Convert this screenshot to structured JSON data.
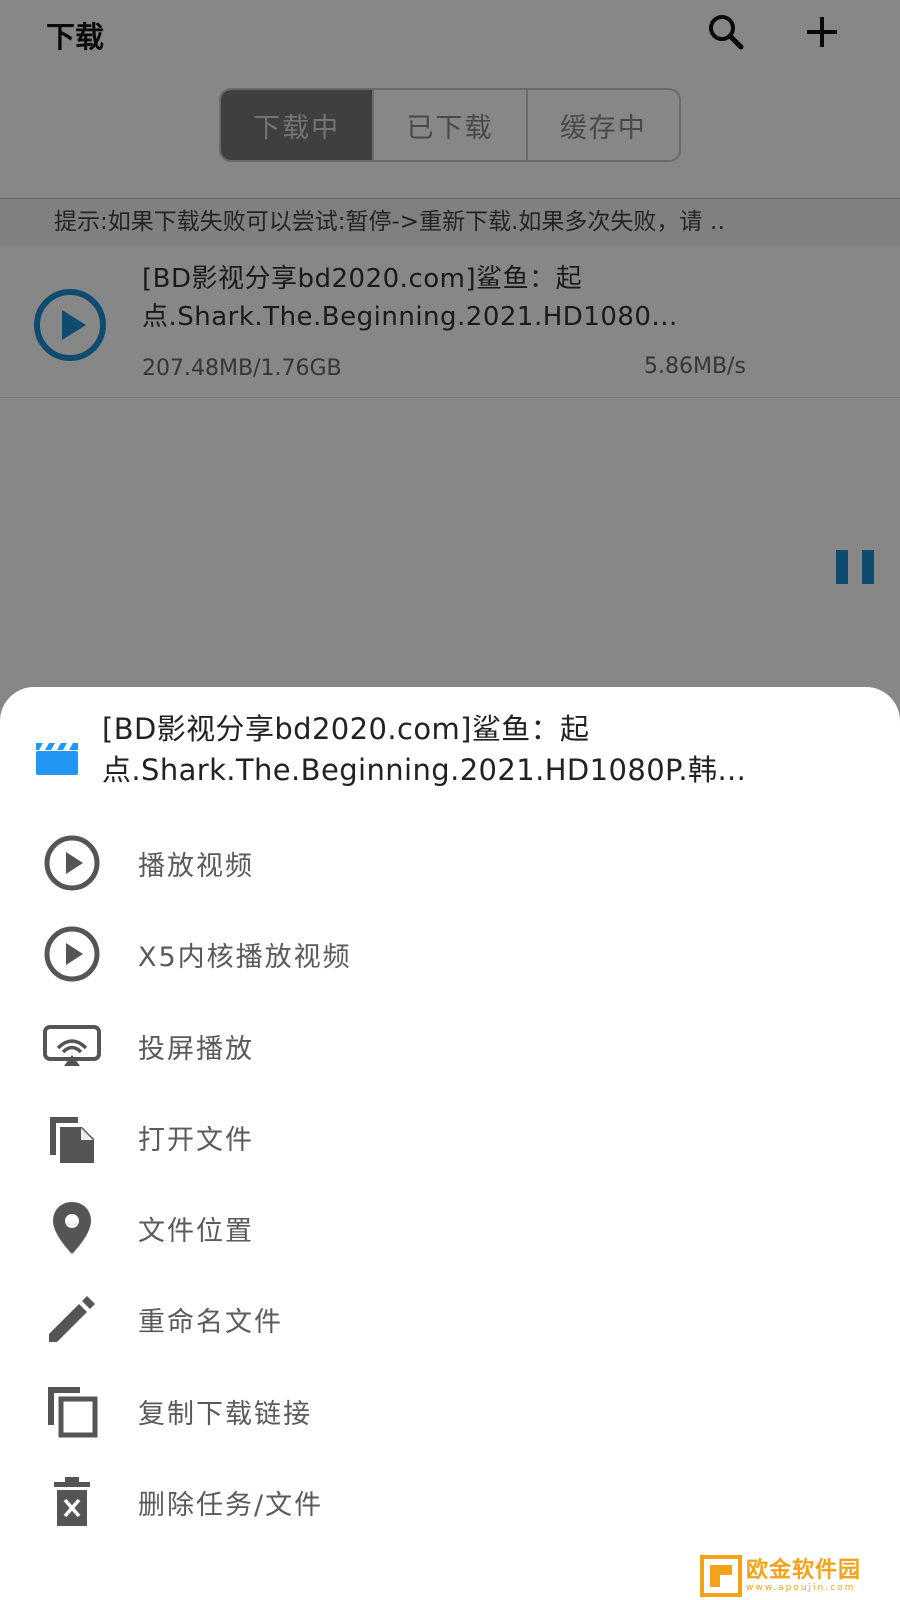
{
  "header": {
    "title": "下载",
    "search_icon": "search-icon",
    "add_icon": "plus-icon"
  },
  "tabs": [
    {
      "label": "下载中",
      "active": true
    },
    {
      "label": "已下载",
      "active": false
    },
    {
      "label": "缓存中",
      "active": false
    }
  ],
  "tip": "提示:如果下载失败可以尝试:暂停->重新下载.如果多次失败，请 ‥",
  "task": {
    "title": "[BD影视分享bd2020.com]鲨鱼：起点.Shark.The.Beginning.2021.HD1080...",
    "size": "207.48MB/1.76GB",
    "speed": "5.86MB/s",
    "state_icon": "pause-icon",
    "accent": "#1d8fd2"
  },
  "sheet": {
    "title": "[BD影视分享bd2020.com]鲨鱼：起点.Shark.The.Beginning.2021.HD1080P.韩...",
    "file_icon": "movie-clapper-icon",
    "items": [
      {
        "label": "播放视频",
        "icon": "play-circle-icon"
      },
      {
        "label": "X5内核播放视频",
        "icon": "play-circle-icon"
      },
      {
        "label": "投屏播放",
        "icon": "cast-icon"
      },
      {
        "label": "打开文件",
        "icon": "file-copy-icon"
      },
      {
        "label": "文件位置",
        "icon": "location-pin-icon"
      },
      {
        "label": "重命名文件",
        "icon": "pencil-icon"
      },
      {
        "label": "复制下载链接",
        "icon": "copy-icon"
      },
      {
        "label": "删除任务/文件",
        "icon": "trash-icon"
      }
    ]
  },
  "watermark": {
    "text": "欧金软件园",
    "url": "www.apoujin.com"
  },
  "colors": {
    "accent_blue": "#1d8fd2",
    "clapper_blue": "#2196f3",
    "scrim": "rgba(0,0,0,0.47)",
    "watermark": "#f4a21c"
  }
}
